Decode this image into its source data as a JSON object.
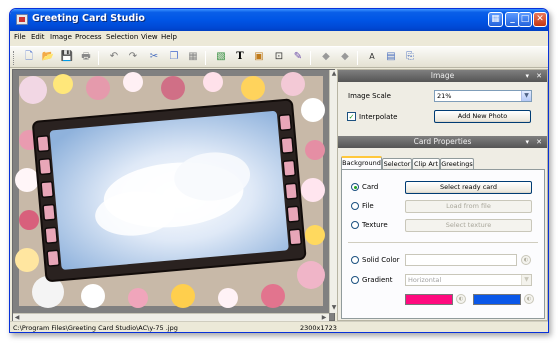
{
  "window": {
    "title": "Greeting Card Studio"
  },
  "menu": [
    "File",
    "Edit",
    "Image",
    "Process",
    "Selection",
    "View",
    "Help"
  ],
  "toolbar_icons": [
    "new-icon",
    "open-icon",
    "save-icon",
    "print-icon",
    "undo-icon",
    "redo-icon",
    "cut-icon",
    "copy-icon",
    "paste-icon",
    "image-icon",
    "text-icon",
    "clipart-icon",
    "frame-icon",
    "paint-icon",
    "left-arrow-icon",
    "right-arrow-icon",
    "font-icon",
    "card-icon",
    "export-icon"
  ],
  "image_panel": {
    "title": "Image",
    "scale_label": "Image Scale",
    "scale_value": "21%",
    "interpolate_label": "Interpolate",
    "interpolate_checked": true,
    "add_photo_label": "Add New Photo"
  },
  "card_panel": {
    "title": "Card Properties",
    "tabs": [
      "Background",
      "Selector",
      "Clip Art",
      "Greetings"
    ],
    "active_tab": "Background",
    "options": {
      "card": {
        "label": "Card",
        "button": "Select ready card",
        "selected": true
      },
      "file": {
        "label": "File",
        "button": "Load from file"
      },
      "texture": {
        "label": "Texture",
        "button": "Select texture"
      },
      "solid": {
        "label": "Solid Color"
      },
      "gradient": {
        "label": "Gradient",
        "combo": "Horizontal"
      }
    },
    "colors": {
      "gradient_start": "#ff0a7f",
      "gradient_end": "#0a57e8"
    }
  },
  "status": {
    "path": "C:\\Program Files\\Greeting Card Studio\\AC\\y-75 .jpg",
    "size": "2300x1723"
  }
}
